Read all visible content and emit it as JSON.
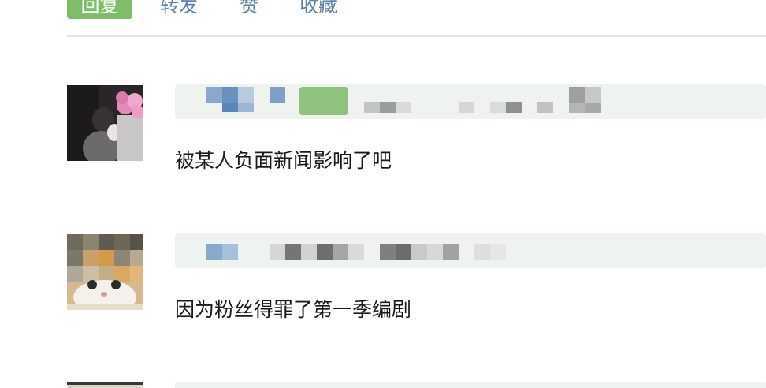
{
  "actions": {
    "reply": "回复",
    "forward": "转发",
    "like": "赞",
    "favorite": "收藏"
  },
  "comments": [
    {
      "text": "被某人负面新闻影响了吧"
    },
    {
      "text": "因为粉丝得罪了第一季编剧"
    },
    {
      "text": ""
    }
  ],
  "colors": {
    "accent_green": "#7ebd6a",
    "link_blue": "#5c7fab",
    "name_band": "#eef3ef",
    "divider": "#e4e4e4"
  }
}
